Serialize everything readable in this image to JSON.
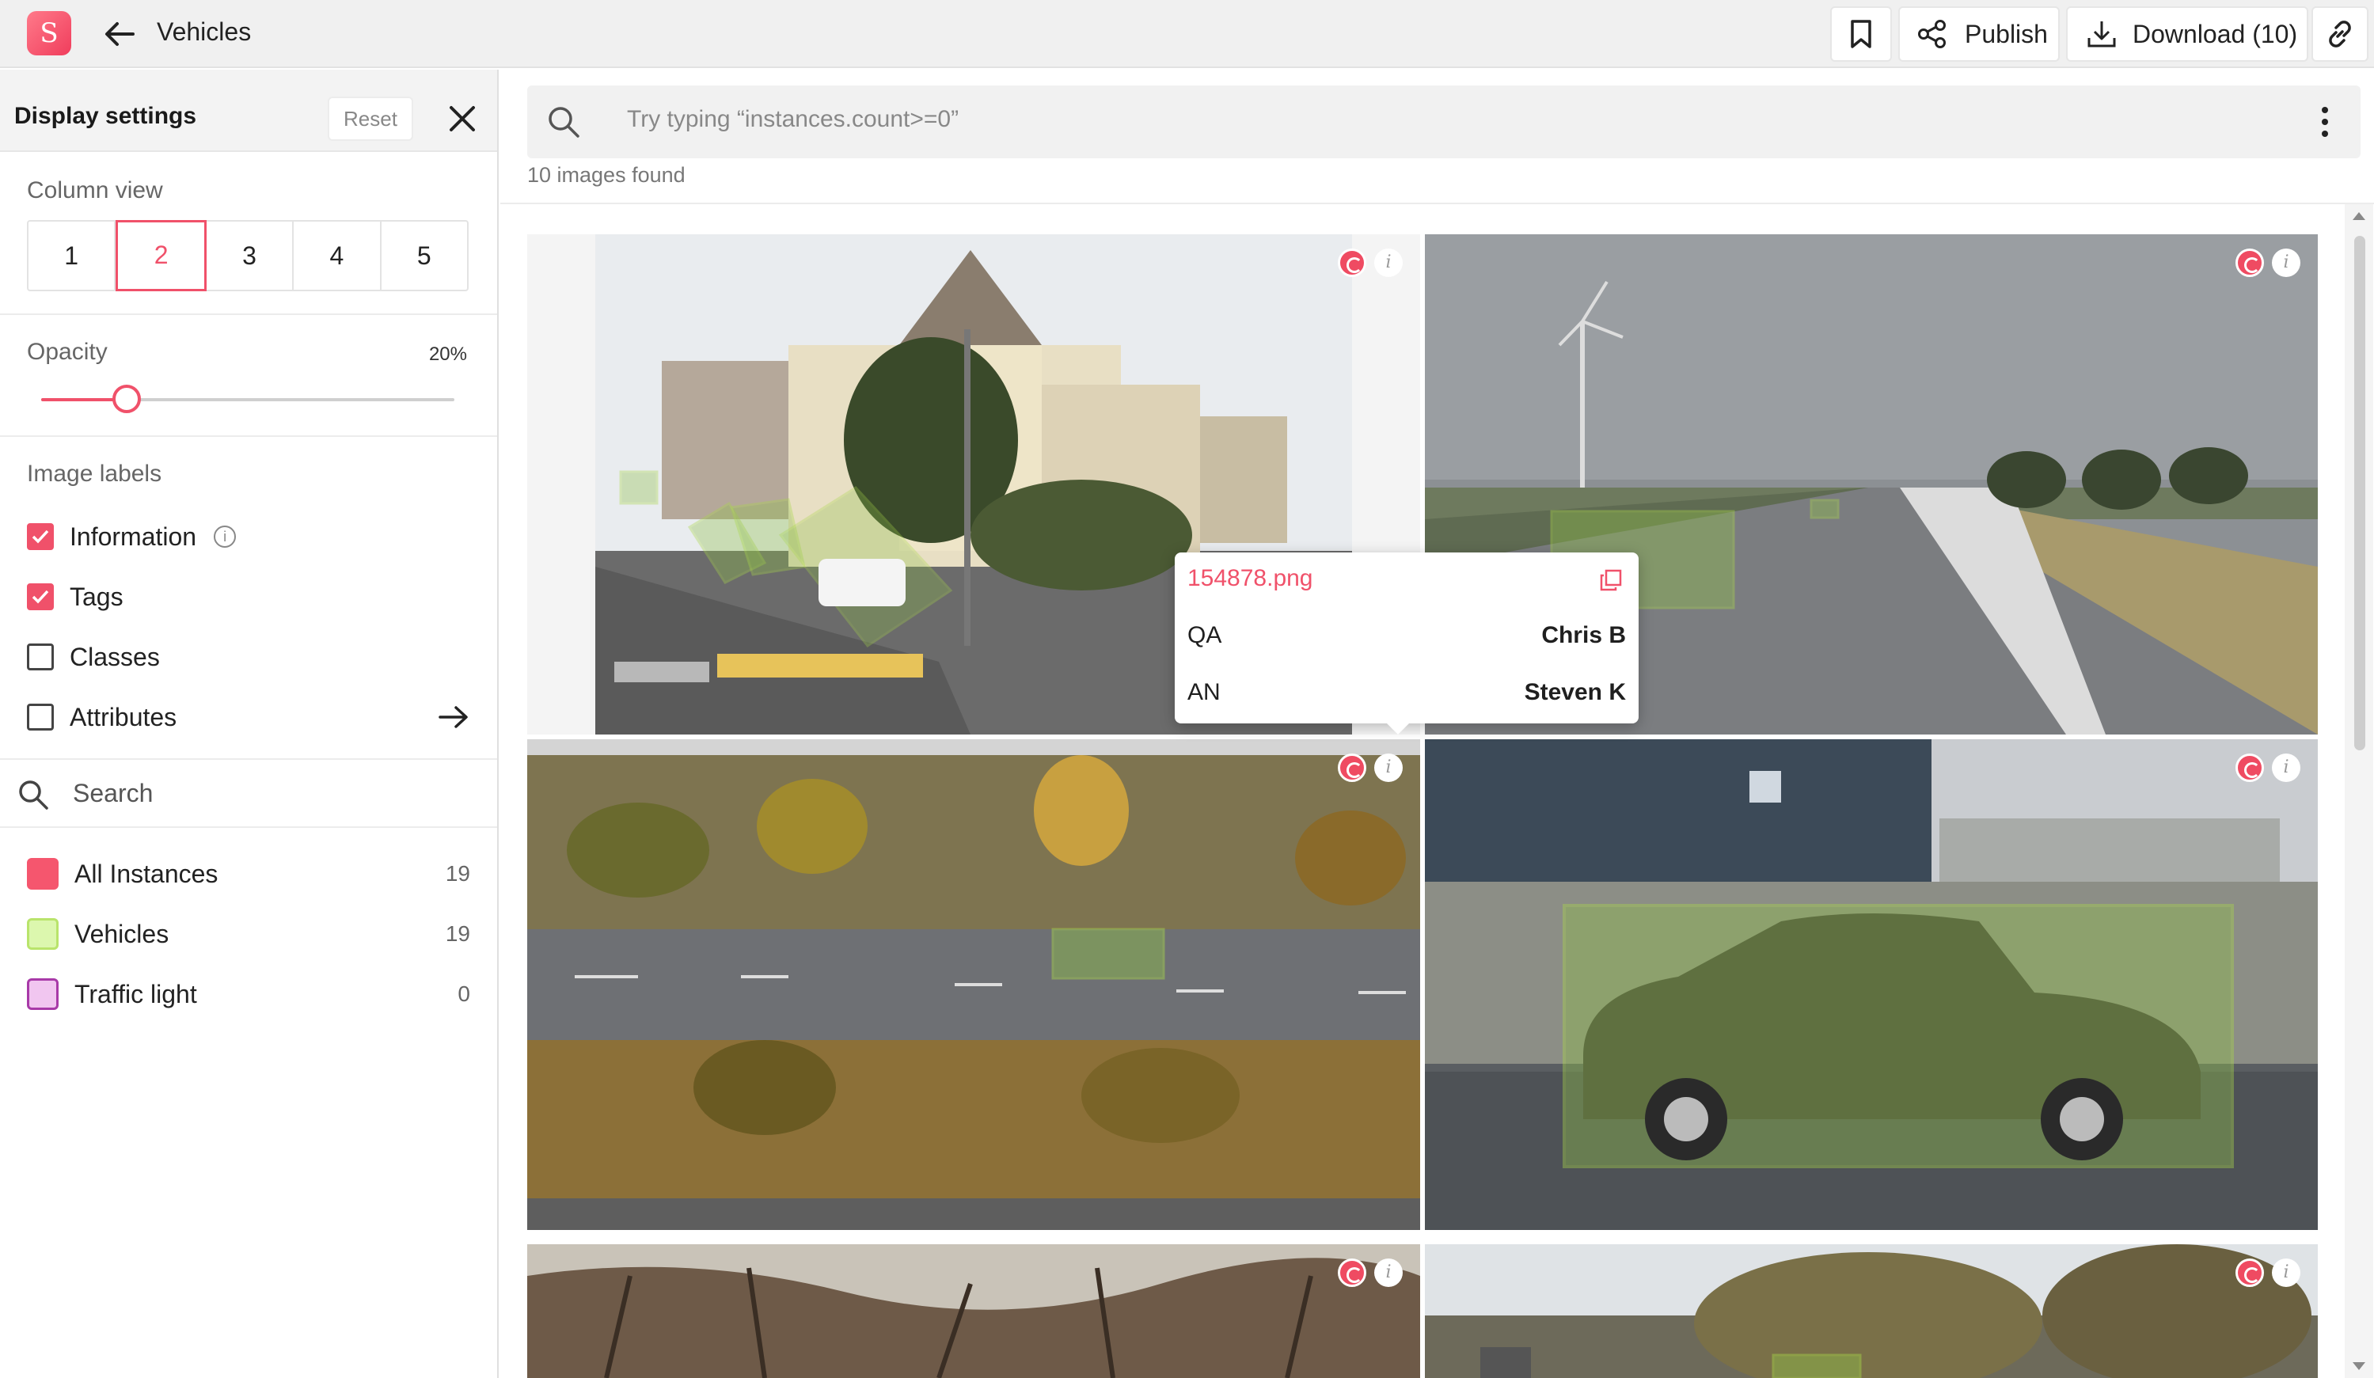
{
  "app": {
    "logo_letter": "S",
    "title": "Vehicles"
  },
  "toolbar": {
    "publish_label": "Publish",
    "download_label": "Download (10)"
  },
  "sidebar": {
    "title": "Display settings",
    "reset_label": "Reset",
    "column_view": {
      "label": "Column view",
      "options": [
        "1",
        "2",
        "3",
        "4",
        "5"
      ],
      "selected": "2"
    },
    "opacity": {
      "label": "Opacity",
      "value_text": "20%",
      "value": 20
    },
    "image_labels": {
      "label": "Image labels",
      "items": [
        {
          "label": "Information",
          "checked": true
        },
        {
          "label": "Tags",
          "checked": true
        },
        {
          "label": "Classes",
          "checked": false
        },
        {
          "label": "Attributes",
          "checked": false
        }
      ]
    },
    "search_placeholder": "Search",
    "classes": [
      {
        "label": "All Instances",
        "count": "19",
        "color": "#f5566e"
      },
      {
        "label": "Vehicles",
        "count": "19",
        "color": "#ccf28f"
      },
      {
        "label": "Traffic light",
        "count": "0",
        "color": "#e9a8e8"
      }
    ]
  },
  "main": {
    "search_placeholder": "Try typing “instances.count>=0”",
    "found_text": "10 images found"
  },
  "tooltip": {
    "filename": "154878.png",
    "rows": [
      {
        "key": "QA",
        "value": "Chris B"
      },
      {
        "key": "AN",
        "value": "Steven K"
      }
    ]
  },
  "colors": {
    "accent": "#f0516a",
    "annotation": "#a8d84a"
  }
}
